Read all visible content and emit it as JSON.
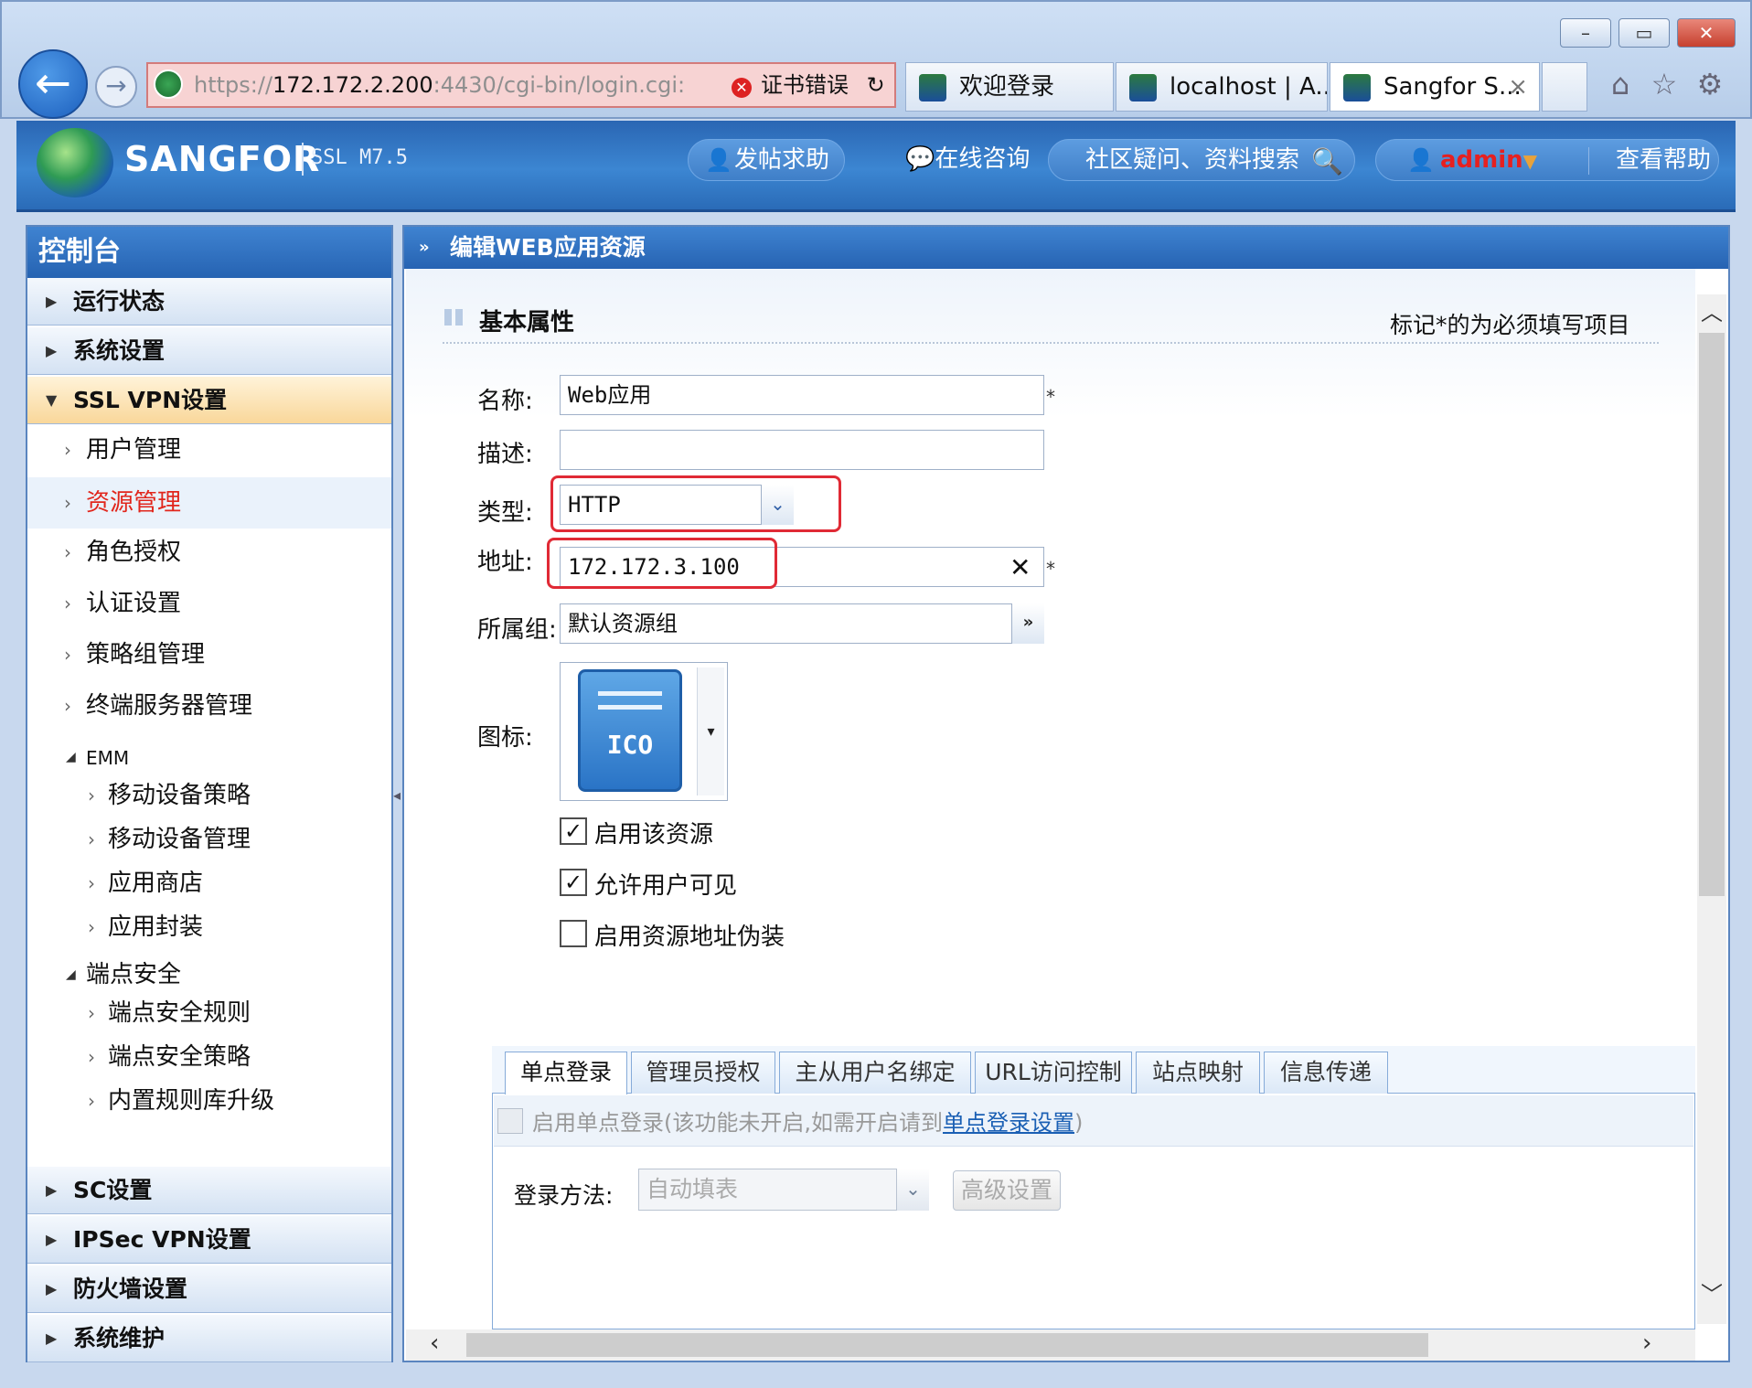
{
  "window": {
    "minimize": "–",
    "maximize": "▭",
    "close": "✕"
  },
  "addressbar": {
    "scheme": "https://",
    "host": "172.172.2.200",
    "rest": ":4430/cgi-bin/login.cgi:",
    "cert_error": "证书错误"
  },
  "tabs": [
    {
      "title": "欢迎登录"
    },
    {
      "title": "localhost | A..."
    },
    {
      "title": "Sangfor S..."
    }
  ],
  "header": {
    "brand": "SANGFOR",
    "version": "SSL M7.5",
    "help_post": "发帖求助",
    "online_consult": "在线咨询",
    "search_placeholder": "社区疑问、资料搜索",
    "username": "admin",
    "view_help": "查看帮助"
  },
  "sidebar": {
    "title": "控制台",
    "sections": {
      "running": "运行状态",
      "system": "系统设置",
      "sslvpn": "SSL VPN设置",
      "sc": "SC设置",
      "ipsec": "IPSec VPN设置",
      "firewall": "防火墙设置",
      "maintenance": "系统维护"
    },
    "items": {
      "user_mgmt": "用户管理",
      "resource_mgmt": "资源管理",
      "role_auth": "角色授权",
      "auth_settings": "认证设置",
      "policy_group": "策略组管理",
      "terminal_server": "终端服务器管理",
      "emm": "EMM",
      "mobile_policy": "移动设备策略",
      "mobile_mgmt": "移动设备管理",
      "app_store": "应用商店",
      "app_wrap": "应用封装",
      "endpoint_security": "端点安全",
      "endpoint_rules": "端点安全规则",
      "endpoint_policy": "端点安全策略",
      "builtin_rule_upgrade": "内置规则库升级"
    }
  },
  "main": {
    "title": "编辑WEB应用资源",
    "section_title": "基本属性",
    "required_note": "标记*的为必须填写项目",
    "fields": {
      "name_label": "名称:",
      "name_value": "Web应用",
      "desc_label": "描述:",
      "desc_value": "",
      "type_label": "类型:",
      "type_value": "HTTP",
      "addr_label": "地址:",
      "addr_value": "172.172.3.100",
      "group_label": "所属组:",
      "group_value": "默认资源组",
      "icon_label": "图标:",
      "icon_text": "ICO",
      "required_star": "*"
    },
    "checkboxes": {
      "enable_resource": "启用该资源",
      "enable_resource_checked": true,
      "user_visible": "允许用户可见",
      "user_visible_checked": true,
      "addr_disguise": "启用资源地址伪装",
      "addr_disguise_checked": false
    },
    "bottom_tabs": [
      "单点登录",
      "管理员授权",
      "主从用户名绑定",
      "URL访问控制",
      "站点映射",
      "信息传递"
    ],
    "sso": {
      "text_prefix": "启用单点登录(该功能未开启,如需开启请到",
      "link": "单点登录设置",
      "text_suffix": ")",
      "login_method_label": "登录方法:",
      "login_method_value": "自动填表",
      "advanced_button": "高级设置"
    }
  }
}
